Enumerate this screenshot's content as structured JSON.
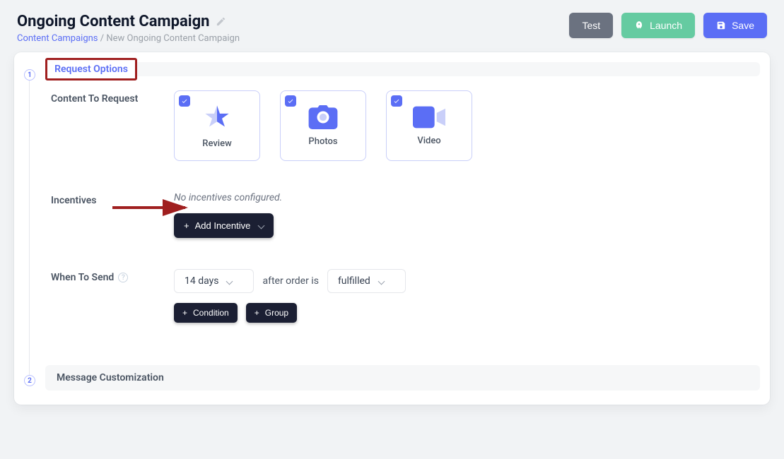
{
  "header": {
    "title": "Ongoing Content Campaign",
    "breadcrumb_link": "Content Campaigns",
    "breadcrumb_sep": "/",
    "breadcrumb_current": "New Ongoing Content Campaign"
  },
  "actions": {
    "test": "Test",
    "launch": "Launch",
    "save": "Save"
  },
  "steps": {
    "one": "1",
    "two": "2",
    "request_options": "Request Options",
    "message_customization": "Message Customization"
  },
  "content_request": {
    "label": "Content To Request",
    "options": [
      {
        "key": "review",
        "label": "Review",
        "checked": true
      },
      {
        "key": "photos",
        "label": "Photos",
        "checked": true
      },
      {
        "key": "video",
        "label": "Video",
        "checked": true
      }
    ]
  },
  "incentives": {
    "label": "Incentives",
    "empty": "No incentives configured.",
    "add_btn": "Add Incentive"
  },
  "when": {
    "label": "When To Send",
    "days_value": "14 days",
    "middle_text": "after order is",
    "status_value": "fulfilled",
    "add_condition": "Condition",
    "add_group": "Group"
  },
  "icons": {
    "plus": "+",
    "chevron": "▾"
  }
}
